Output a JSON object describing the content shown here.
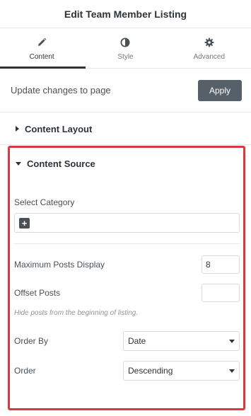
{
  "header": {
    "title": "Edit Team Member Listing"
  },
  "tabs": [
    {
      "label": "Content",
      "icon": "pencil-icon"
    },
    {
      "label": "Style",
      "icon": "half-circle-icon"
    },
    {
      "label": "Advanced",
      "icon": "gear-icon"
    }
  ],
  "update": {
    "label": "Update changes to page",
    "button": "Apply"
  },
  "sections": {
    "layout": {
      "title": "Content Layout",
      "expanded": false
    },
    "source": {
      "title": "Content Source",
      "expanded": true,
      "category_label": "Select Category",
      "max_posts_label": "Maximum Posts Display",
      "max_posts_value": "8",
      "offset_label": "Offset Posts",
      "offset_value": "",
      "offset_hint": "Hide posts from the beginning of listing.",
      "order_by_label": "Order By",
      "order_by_value": "Date",
      "order_label": "Order",
      "order_value": "Descending"
    }
  },
  "colors": {
    "highlight": "#d93a3f",
    "apply_button": "#556068"
  }
}
